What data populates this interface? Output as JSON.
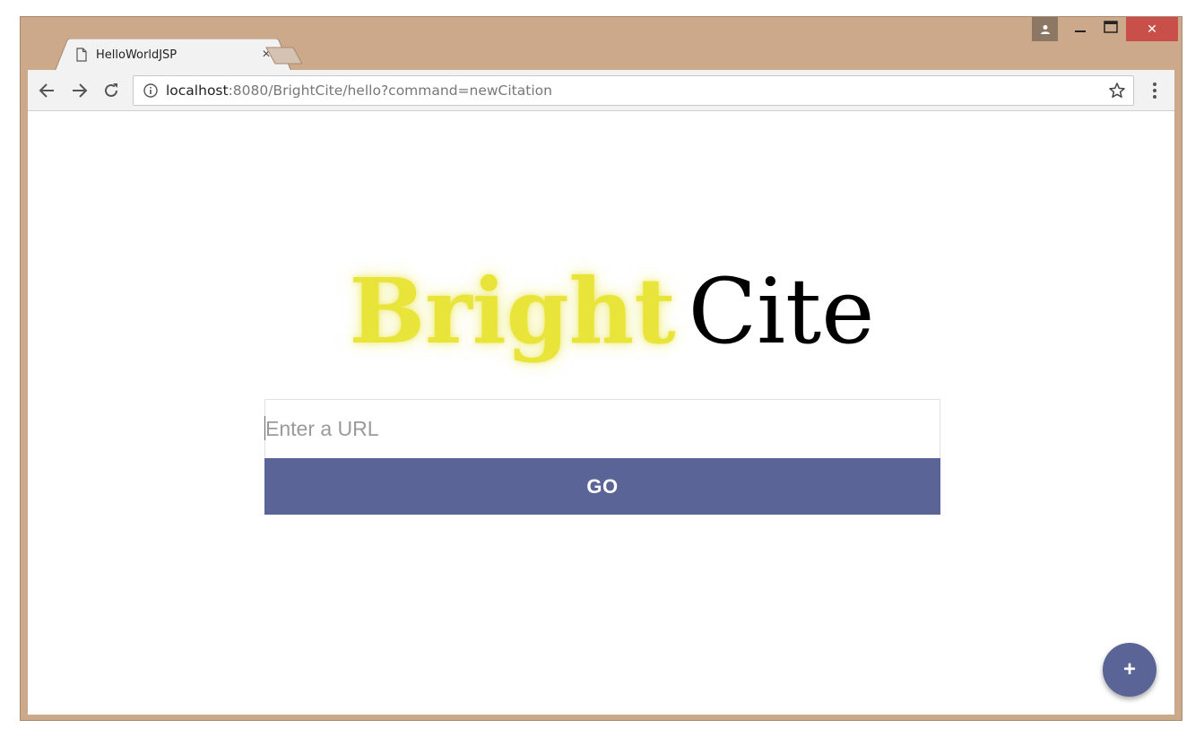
{
  "browser": {
    "tab_title": "HelloWorldJSP",
    "tab_close": "×",
    "url_host": "localhost",
    "url_rest": ":8080/BrightCite/hello?command=newCitation",
    "close_glyph": "✕"
  },
  "page": {
    "logo_part1": "Bright",
    "logo_part2": "Cite",
    "url_placeholder": "Enter a URL",
    "go_label": "GO",
    "fab_label": "+"
  },
  "colors": {
    "accent": "#5a6497",
    "logo_yellow": "#e8e43a",
    "frame": "#cba98a",
    "close_red": "#c9504a"
  }
}
